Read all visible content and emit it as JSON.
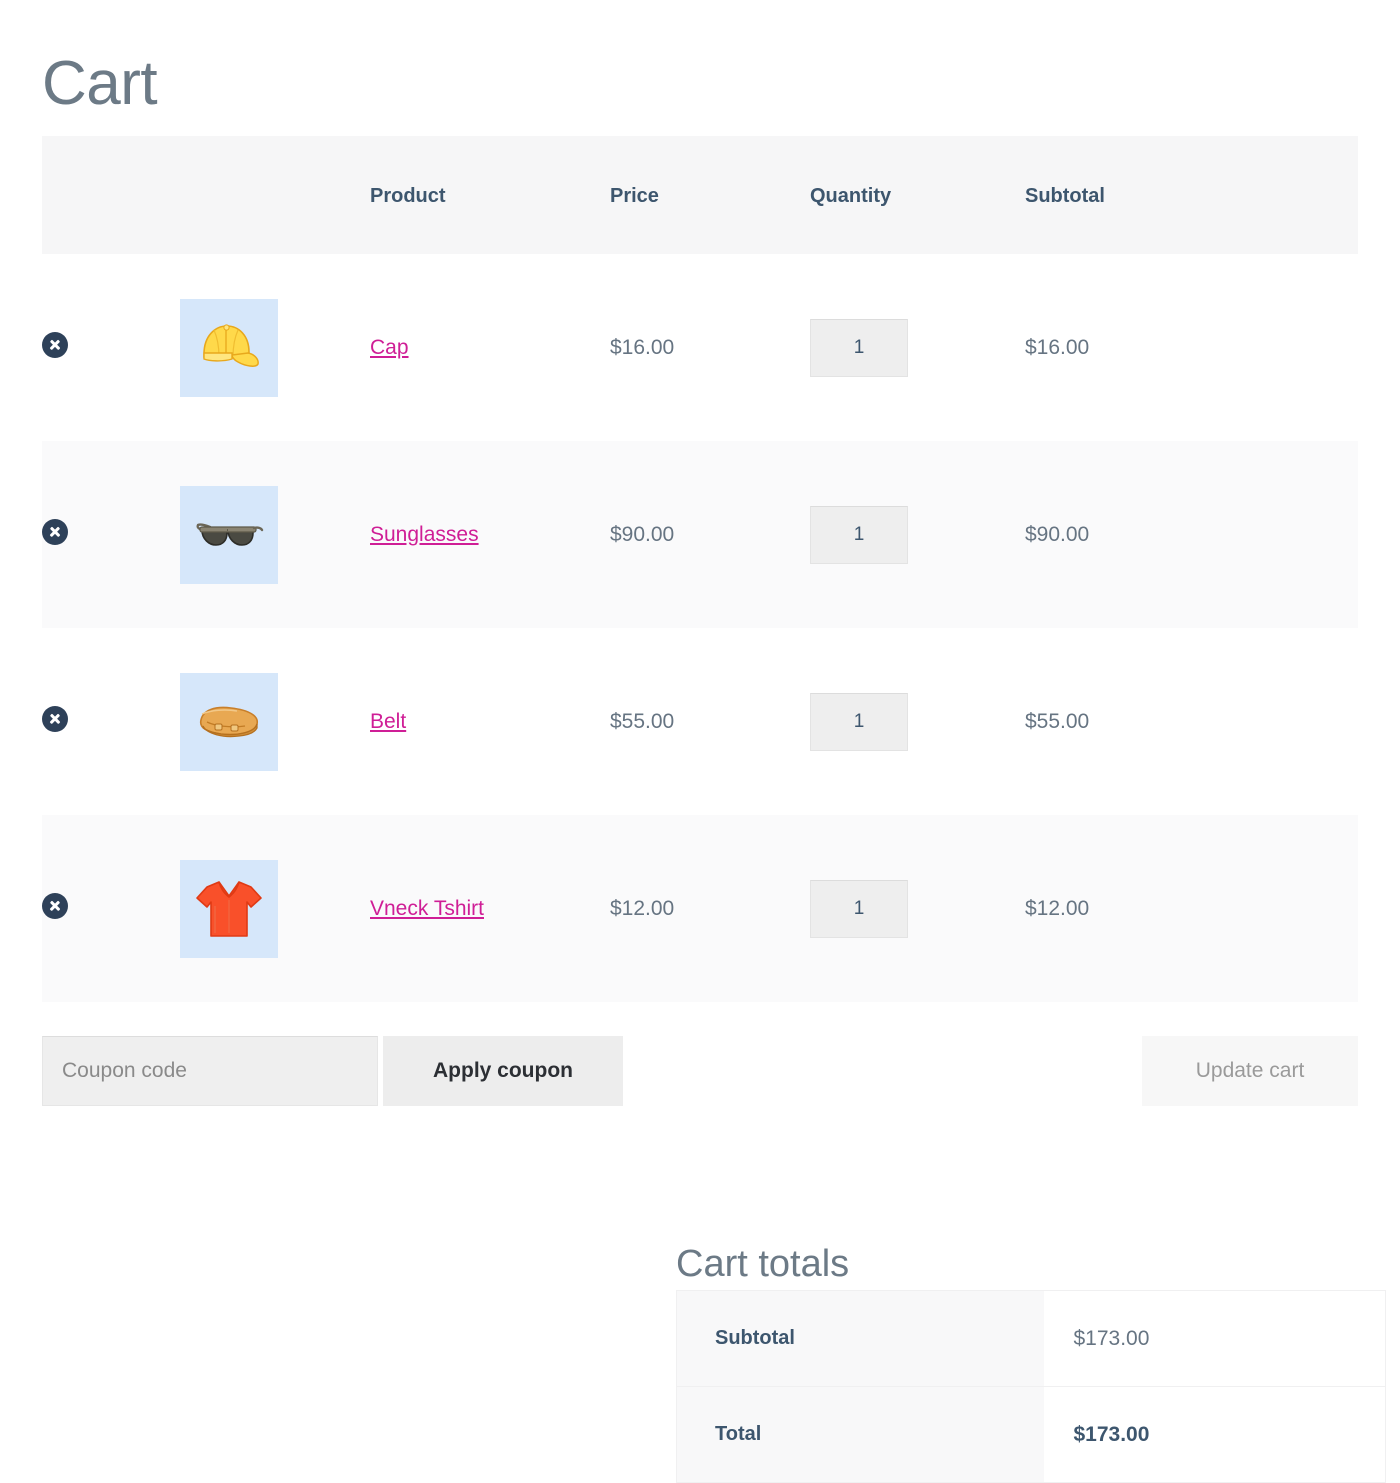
{
  "page": {
    "title": "Cart"
  },
  "cart_table": {
    "columns": [
      "",
      "",
      "Product",
      "Price",
      "Quantity",
      "Subtotal"
    ],
    "headers": {
      "remove": "",
      "thumbnail": "",
      "product": "Product",
      "price": "Price",
      "quantity": "Quantity",
      "subtotal": "Subtotal"
    },
    "remove_icon": "remove-circle-x-icon",
    "rows": [
      {
        "name": "Cap",
        "image": "yellow-baseball-cap",
        "price": "$16.00",
        "quantity": "1",
        "subtotal": "$16.00"
      },
      {
        "name": "Sunglasses",
        "image": "black-sunglasses",
        "price": "$90.00",
        "quantity": "1",
        "subtotal": "$90.00"
      },
      {
        "name": "Belt",
        "image": "tan-leather-belt",
        "price": "$55.00",
        "quantity": "1",
        "subtotal": "$55.00"
      },
      {
        "name": "Vneck Tshirt",
        "image": "orange-vneck-tshirt",
        "price": "$12.00",
        "quantity": "1",
        "subtotal": "$12.00"
      }
    ]
  },
  "actions": {
    "coupon_placeholder": "Coupon code",
    "coupon_value": "",
    "apply_coupon_label": "Apply coupon",
    "update_cart_label": "Update cart"
  },
  "cart_totals": {
    "heading": "Cart totals",
    "rows": [
      {
        "label": "Subtotal",
        "value": "$173.00"
      },
      {
        "label": "Total",
        "value": "$173.00"
      }
    ]
  },
  "colors": {
    "link": "#cf1e96",
    "heading": "#3d566e",
    "title": "#6c7a86",
    "body_text": "#667482",
    "thumb_bg": "#d6e7fa",
    "header_bg": "#f6f6f7",
    "alt_row_bg": "#fafafb"
  }
}
